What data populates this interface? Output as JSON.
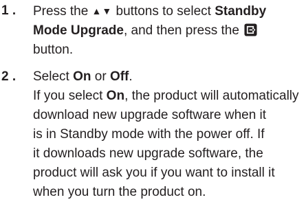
{
  "steps": [
    {
      "number": "1 .",
      "line1_a": "Press the",
      "arrows": "▲▼",
      "line1_b": "buttons to select",
      "line1_bold": "Standby",
      "line2_bold": "Mode Upgrade",
      "line2_rest": ", and then press the",
      "enter_icon": "enter-icon",
      "line3": "button."
    },
    {
      "number": "2 .",
      "line1_a": "Select",
      "on_bold": "On",
      "or": "or",
      "off_bold": "Off",
      "dot": ".",
      "desc_a": "If you select",
      "desc_on": "On",
      "desc_b": ", the product will automatically",
      "lines": [
        "download new upgrade software when it",
        "is in Standby mode with the power off. If",
        "it downloads new upgrade software, the",
        "product will ask you if you want to install it",
        "when you turn the product on."
      ]
    }
  ]
}
